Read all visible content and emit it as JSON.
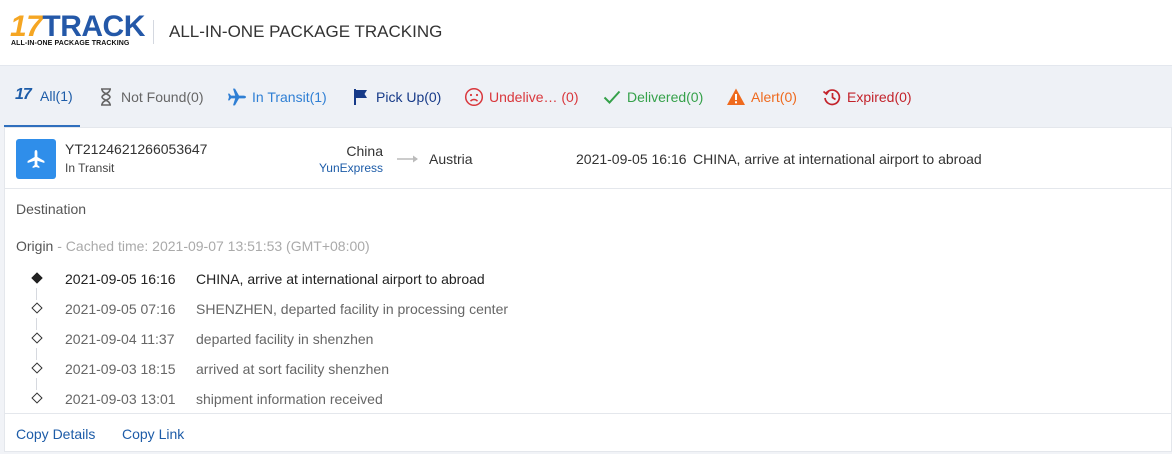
{
  "header": {
    "logo_main": "17TRACK",
    "logo_number": "17",
    "logo_word": "TRACK",
    "logo_sub": "ALL-IN-ONE PACKAGE TRACKING",
    "title": "ALL-IN-ONE PACKAGE TRACKING"
  },
  "tabs": [
    {
      "label": "All(1)",
      "icon": "17track-icon",
      "color": "#1d5ca8"
    },
    {
      "label": "Not Found(0)",
      "icon": "hourglass-icon",
      "color": "#666666"
    },
    {
      "label": "In Transit(1)",
      "icon": "airplane-icon",
      "color": "#2f7fd4"
    },
    {
      "label": "Pick Up(0)",
      "icon": "flag-icon",
      "color": "#163a88"
    },
    {
      "label": "Undelive… (0)",
      "icon": "sad-face-icon",
      "color": "#d9373c"
    },
    {
      "label": "Delivered(0)",
      "icon": "checkmark-icon",
      "color": "#35a14a"
    },
    {
      "label": "Alert(0)",
      "icon": "warning-icon",
      "color": "#ef6a1e"
    },
    {
      "label": "Expired(0)",
      "icon": "history-icon",
      "color": "#c3232b"
    }
  ],
  "tabs_all_icon_text": "17",
  "package": {
    "tracking_number": "YT2124621266053647",
    "status": "In Transit",
    "status_icon": "airplane-icon",
    "origin_country": "China",
    "carrier": "YunExpress",
    "destination_country": "Austria",
    "latest_time": "2021-09-05 16:16",
    "latest_description": "CHINA, arrive at international airport to abroad"
  },
  "details": {
    "destination_label": "Destination",
    "origin_label": "Origin",
    "cached_text": " - Cached time: 2021-09-07 13:51:53 (GMT+08:00)"
  },
  "events": [
    {
      "time": "2021-09-05 16:16",
      "description": "CHINA, arrive at international airport to abroad"
    },
    {
      "time": "2021-09-05 07:16",
      "description": "SHENZHEN, departed facility in processing center"
    },
    {
      "time": "2021-09-04 11:37",
      "description": "departed facility in shenzhen"
    },
    {
      "time": "2021-09-03 18:15",
      "description": "arrived at sort facility shenzhen"
    },
    {
      "time": "2021-09-03 13:01",
      "description": "shipment information received"
    }
  ],
  "footer": {
    "copy_details": "Copy Details",
    "copy_link": "Copy Link"
  }
}
